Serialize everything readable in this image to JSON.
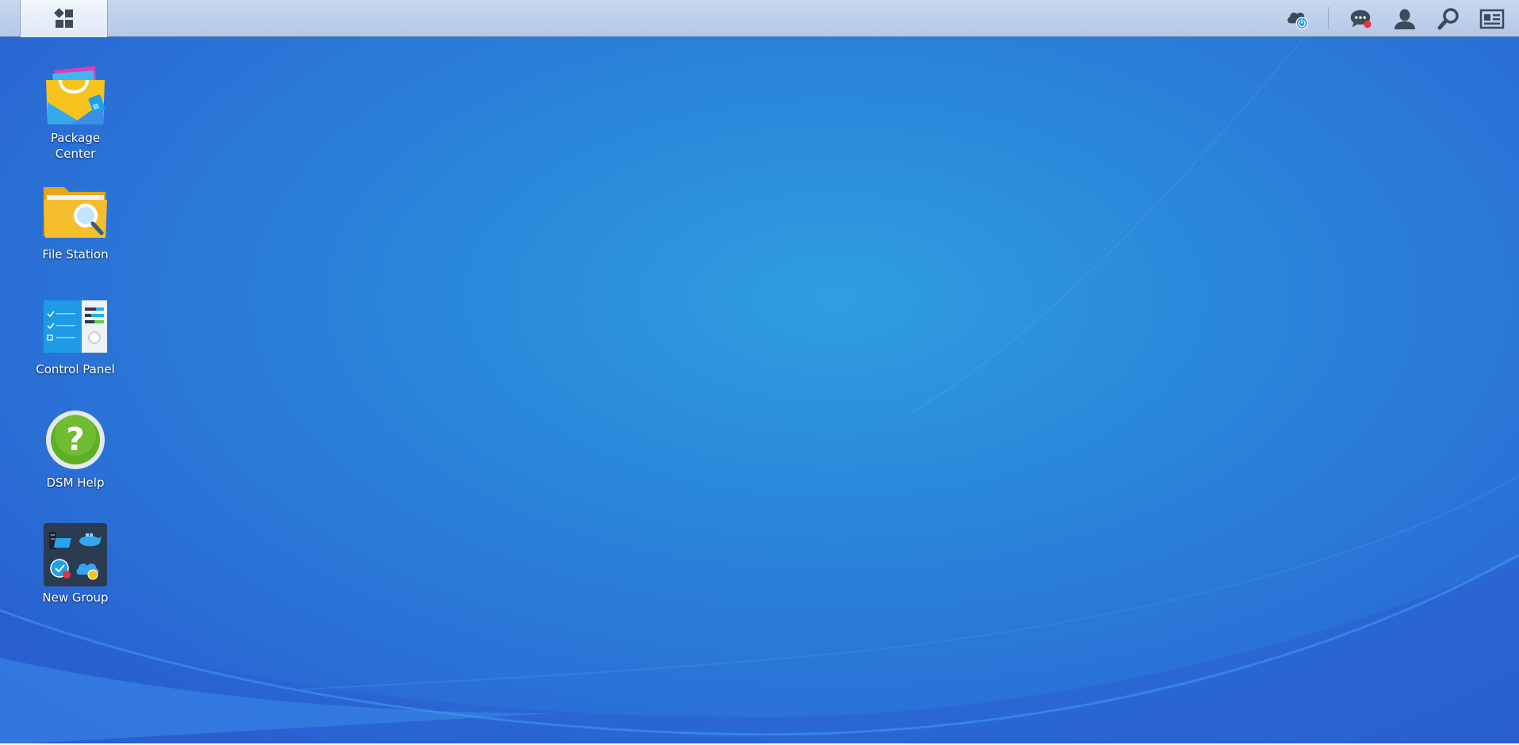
{
  "taskbar": {
    "main_menu_icon": "main-menu-icon",
    "tray": [
      {
        "name": "cloud-sync-status",
        "icon": "cloud-power-icon"
      },
      {
        "name": "notifications",
        "icon": "chat-bubble-icon",
        "badge_color": "#e8323c"
      },
      {
        "name": "user-options",
        "icon": "user-icon"
      },
      {
        "name": "search",
        "icon": "search-icon"
      },
      {
        "name": "widgets",
        "icon": "widgets-icon"
      }
    ]
  },
  "desktop": {
    "shortcuts": [
      {
        "label": "Package Center",
        "icon": "package-center-icon"
      },
      {
        "label": "File Station",
        "icon": "file-station-icon"
      },
      {
        "label": "Control Panel",
        "icon": "control-panel-icon"
      },
      {
        "label": "DSM Help",
        "icon": "help-icon"
      },
      {
        "label": "New Group",
        "icon": "app-group-icon"
      }
    ]
  },
  "colors": {
    "desktop_blue": "#2a86da",
    "taskbar_bg": "#c0d1eb",
    "icon_dark": "#3d4a5c"
  }
}
